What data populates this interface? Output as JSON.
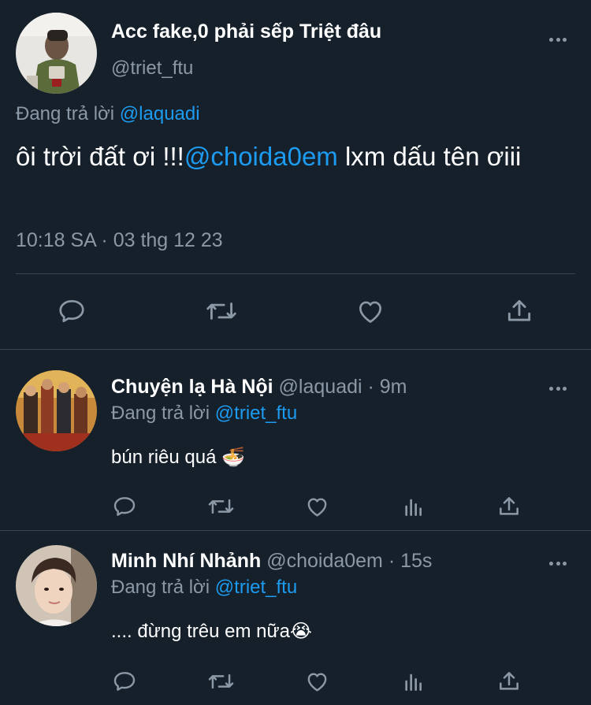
{
  "main_tweet": {
    "display_name": "Acc fake,0 phải sếp Triệt đâu",
    "handle": "@triet_ftu",
    "replying_label": "Đang trả lời",
    "replying_to": "@laquadi",
    "text_before": "ôi trời đất ơi !!!",
    "text_mention": "@choida0em",
    "text_after": " lxm dấu tên ơiii",
    "timestamp": "10:18 SA · 03 thg 12 23",
    "actions": [
      "reply-icon",
      "retweet-icon",
      "like-icon",
      "share-icon"
    ]
  },
  "replies": [
    {
      "display_name": "Chuyện lạ Hà Nội",
      "handle": "@laquadi",
      "time": "9m",
      "replying_label": "Đang trả lời",
      "replying_to": "@triet_ftu",
      "text": "bún riêu quá 🍜",
      "actions": [
        "reply-icon",
        "retweet-icon",
        "like-icon",
        "analytics-icon",
        "share-icon"
      ]
    },
    {
      "display_name": "Minh Nhí Nhảnh",
      "handle": "@choida0em",
      "time": "15s",
      "replying_label": "Đang trả lời",
      "replying_to": "@triet_ftu",
      "text": ".... đừng trêu em nữa😭",
      "actions": [
        "reply-icon",
        "retweet-icon",
        "like-icon",
        "analytics-icon",
        "share-icon"
      ]
    }
  ],
  "colors": {
    "background": "#15202b",
    "text": "#ffffff",
    "muted": "#8b98a5",
    "link": "#1d9bf0",
    "divider": "#38444d"
  }
}
